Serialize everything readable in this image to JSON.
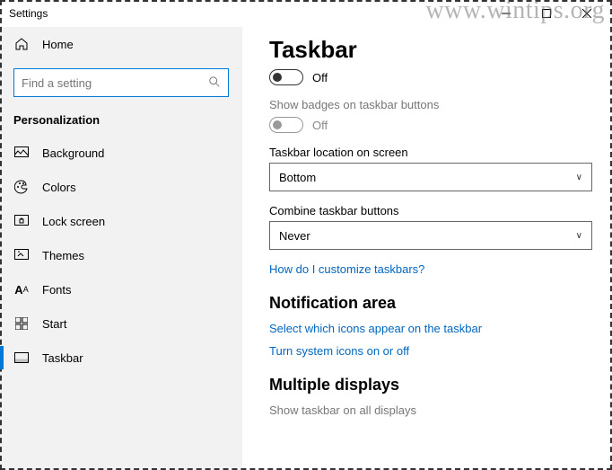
{
  "window": {
    "title": "Settings"
  },
  "sidebar": {
    "home": "Home",
    "search_placeholder": "Find a setting",
    "category": "Personalization",
    "items": [
      {
        "label": "Background"
      },
      {
        "label": "Colors"
      },
      {
        "label": "Lock screen"
      },
      {
        "label": "Themes"
      },
      {
        "label": "Fonts"
      },
      {
        "label": "Start"
      },
      {
        "label": "Taskbar"
      }
    ]
  },
  "main": {
    "title": "Taskbar",
    "toggle1_label": "Off",
    "badges_label": "Show badges on taskbar buttons",
    "toggle2_label": "Off",
    "location_label": "Taskbar location on screen",
    "location_value": "Bottom",
    "combine_label": "Combine taskbar buttons",
    "combine_value": "Never",
    "customize_link": "How do I customize taskbars?",
    "notif_heading": "Notification area",
    "notif_link1": "Select which icons appear on the taskbar",
    "notif_link2": "Turn system icons on or off",
    "multi_heading": "Multiple displays",
    "multi_label": "Show taskbar on all displays"
  },
  "watermark": "www.wintips.org"
}
